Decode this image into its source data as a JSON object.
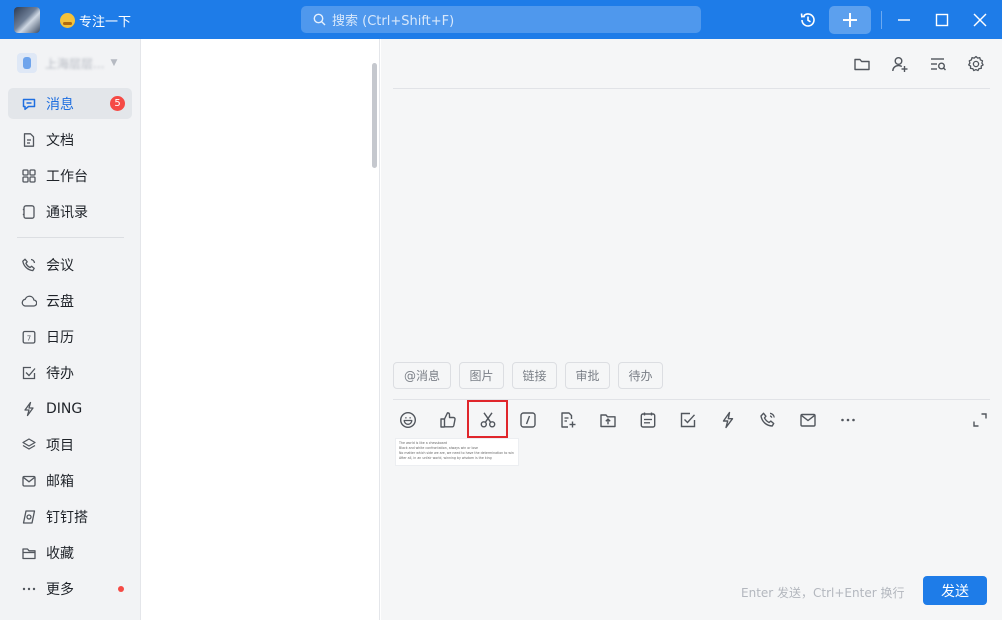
{
  "titlebar": {
    "status_text": "专注一下",
    "search_placeholder": "搜索 (Ctrl+Shift+F)"
  },
  "sidebar": {
    "org_name": "上海层层...",
    "nav": [
      {
        "label": "消息",
        "icon": "message-icon",
        "badge": "5"
      },
      {
        "label": "文档",
        "icon": "document-icon"
      },
      {
        "label": "工作台",
        "icon": "grid-icon"
      },
      {
        "label": "通讯录",
        "icon": "contacts-icon"
      },
      {
        "label": "会议",
        "icon": "phone-icon"
      },
      {
        "label": "云盘",
        "icon": "cloud-icon"
      },
      {
        "label": "日历",
        "icon": "calendar-icon"
      },
      {
        "label": "待办",
        "icon": "checkbox-icon"
      },
      {
        "label": "DING",
        "icon": "lightning-icon"
      },
      {
        "label": "项目",
        "icon": "layers-icon"
      },
      {
        "label": "邮箱",
        "icon": "mail-icon"
      },
      {
        "label": "钉钉搭",
        "icon": "builder-icon"
      },
      {
        "label": "收藏",
        "icon": "folder-icon"
      },
      {
        "label": "更多",
        "icon": "more-icon"
      }
    ]
  },
  "chat": {
    "quick_chips": [
      "@消息",
      "图片",
      "链接",
      "审批",
      "待办"
    ],
    "attachment_lines": [
      "The world is like a chessboard",
      "Black and white confrontation, always win or lose",
      "No matter which side we are, we need to have the determination to win",
      "After all, in an unfair world, winning by wisdom is the king"
    ],
    "hint": "Enter 发送，Ctrl+Enter 换行",
    "send_label": "发送"
  },
  "colors": {
    "accent": "#1e7ce8",
    "badge": "#f54a45",
    "highlight": "#e0262b"
  }
}
